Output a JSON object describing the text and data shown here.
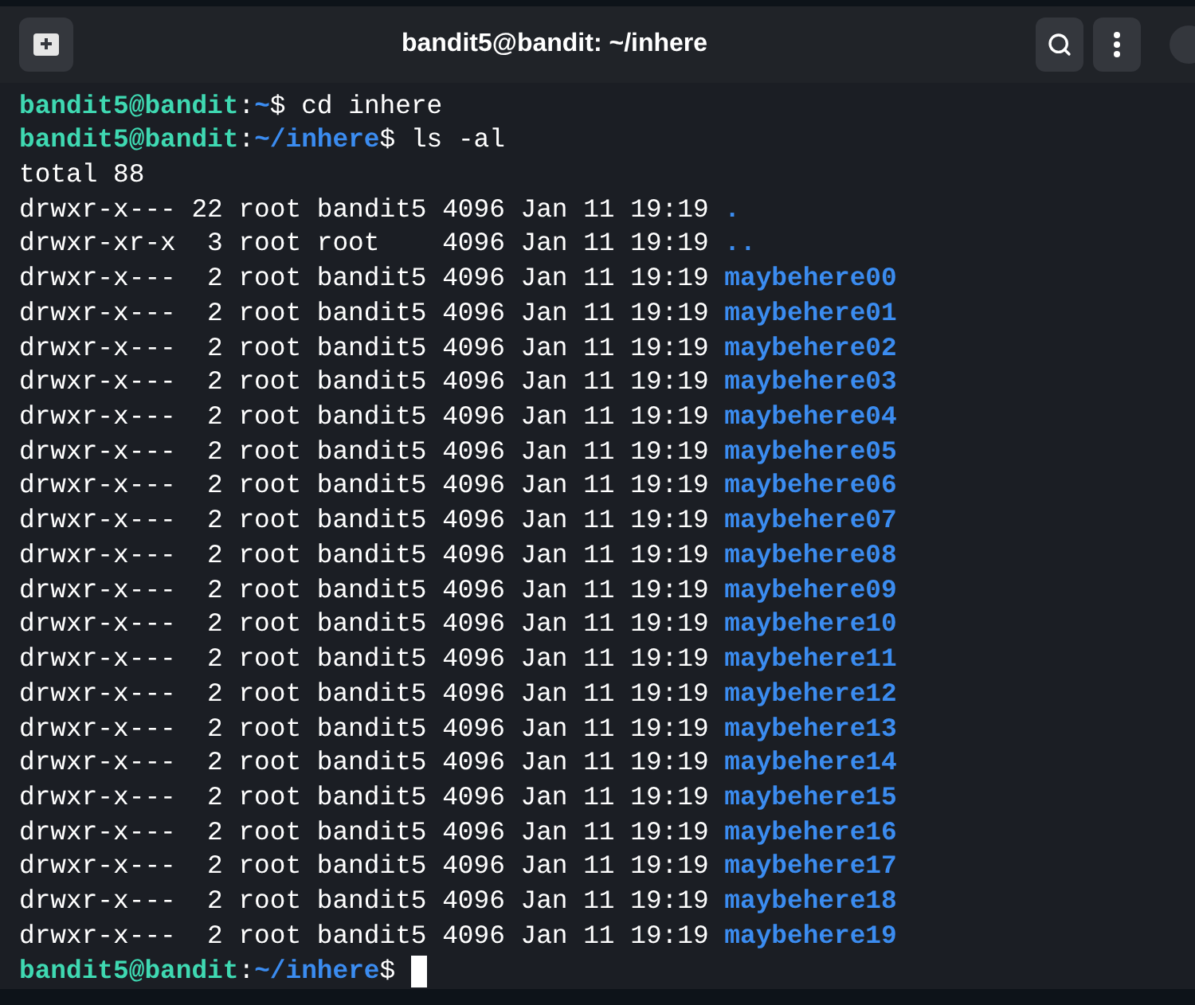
{
  "window": {
    "title": "bandit5@bandit: ~/inhere"
  },
  "terminal": {
    "lines": [
      {
        "kind": "prompt",
        "user": "bandit5@bandit",
        "colon": ":",
        "path": "~",
        "dollar": "$",
        "command": "cd inhere",
        "cursor": false
      },
      {
        "kind": "prompt",
        "user": "bandit5@bandit",
        "colon": ":",
        "path": "~/inhere",
        "dollar": "$",
        "command": "ls -al",
        "cursor": false
      },
      {
        "kind": "text",
        "text": "total 88"
      },
      {
        "kind": "entry",
        "info": "drwxr-x--- 22 root bandit5 4096 Jan 11 19:19",
        "name": "."
      },
      {
        "kind": "entry",
        "info": "drwxr-xr-x  3 root root    4096 Jan 11 19:19",
        "name": ".."
      },
      {
        "kind": "entry",
        "info": "drwxr-x---  2 root bandit5 4096 Jan 11 19:19",
        "name": "maybehere00"
      },
      {
        "kind": "entry",
        "info": "drwxr-x---  2 root bandit5 4096 Jan 11 19:19",
        "name": "maybehere01"
      },
      {
        "kind": "entry",
        "info": "drwxr-x---  2 root bandit5 4096 Jan 11 19:19",
        "name": "maybehere02"
      },
      {
        "kind": "entry",
        "info": "drwxr-x---  2 root bandit5 4096 Jan 11 19:19",
        "name": "maybehere03"
      },
      {
        "kind": "entry",
        "info": "drwxr-x---  2 root bandit5 4096 Jan 11 19:19",
        "name": "maybehere04"
      },
      {
        "kind": "entry",
        "info": "drwxr-x---  2 root bandit5 4096 Jan 11 19:19",
        "name": "maybehere05"
      },
      {
        "kind": "entry",
        "info": "drwxr-x---  2 root bandit5 4096 Jan 11 19:19",
        "name": "maybehere06"
      },
      {
        "kind": "entry",
        "info": "drwxr-x---  2 root bandit5 4096 Jan 11 19:19",
        "name": "maybehere07"
      },
      {
        "kind": "entry",
        "info": "drwxr-x---  2 root bandit5 4096 Jan 11 19:19",
        "name": "maybehere08"
      },
      {
        "kind": "entry",
        "info": "drwxr-x---  2 root bandit5 4096 Jan 11 19:19",
        "name": "maybehere09"
      },
      {
        "kind": "entry",
        "info": "drwxr-x---  2 root bandit5 4096 Jan 11 19:19",
        "name": "maybehere10"
      },
      {
        "kind": "entry",
        "info": "drwxr-x---  2 root bandit5 4096 Jan 11 19:19",
        "name": "maybehere11"
      },
      {
        "kind": "entry",
        "info": "drwxr-x---  2 root bandit5 4096 Jan 11 19:19",
        "name": "maybehere12"
      },
      {
        "kind": "entry",
        "info": "drwxr-x---  2 root bandit5 4096 Jan 11 19:19",
        "name": "maybehere13"
      },
      {
        "kind": "entry",
        "info": "drwxr-x---  2 root bandit5 4096 Jan 11 19:19",
        "name": "maybehere14"
      },
      {
        "kind": "entry",
        "info": "drwxr-x---  2 root bandit5 4096 Jan 11 19:19",
        "name": "maybehere15"
      },
      {
        "kind": "entry",
        "info": "drwxr-x---  2 root bandit5 4096 Jan 11 19:19",
        "name": "maybehere16"
      },
      {
        "kind": "entry",
        "info": "drwxr-x---  2 root bandit5 4096 Jan 11 19:19",
        "name": "maybehere17"
      },
      {
        "kind": "entry",
        "info": "drwxr-x---  2 root bandit5 4096 Jan 11 19:19",
        "name": "maybehere18"
      },
      {
        "kind": "entry",
        "info": "drwxr-x---  2 root bandit5 4096 Jan 11 19:19",
        "name": "maybehere19"
      },
      {
        "kind": "prompt",
        "user": "bandit5@bandit",
        "colon": ":",
        "path": "~/inhere",
        "dollar": "$",
        "cursor": true
      }
    ]
  }
}
